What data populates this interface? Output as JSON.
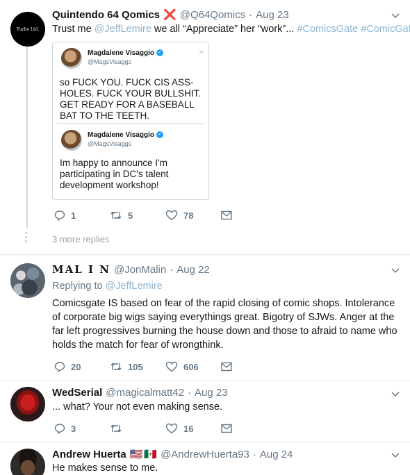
{
  "tweet1": {
    "avatar_text": "Turbo Ltd.",
    "name": "Quintendo 64 Qomics",
    "badge": "❌",
    "handle": "@Q64Qomics",
    "sep": "·",
    "date": "Aug 23",
    "text_prefix": "Trust me ",
    "mention": "@JeffLemire",
    "text_mid": " we all “Appreciate” her “work”... ",
    "hashtag1": "#ComicsGate",
    "hashtag_gap": " ",
    "hashtag2": "#ComicGate",
    "quote1": {
      "name": "Magdalene Visaggio",
      "handle": "@MagsVisaggs",
      "text": "so FUCK YOU. FUCK CIS ASS-HOLES. FUCK YOUR BULLSHIT. GET READY FOR A BASEBALL BAT TO THE TEETH."
    },
    "quote2": {
      "name": "Magdalene Visaggio",
      "handle": "@MagsVisaggs",
      "text": "Im happy to announce I'm participating in DC's talent development workshop!"
    },
    "replies": "1",
    "retweets": "5",
    "likes": "78"
  },
  "more_replies": "3 more replies",
  "tweet2": {
    "name": "MAL I N",
    "handle": "@JonMalin",
    "sep": "·",
    "date": "Aug 22",
    "replying_prefix": "Replying to ",
    "replying_to": "@JeffLemire",
    "text": "Comicsgate IS based on fear of the rapid closing of comic shops. Intolerance of corporate big wigs saying everythings great. Bigotry of SJWs. Anger at the far left progressives burning the house down and those to afraid to name who holds the match for fear of wrongthink.",
    "replies": "20",
    "retweets": "105",
    "likes": "606"
  },
  "tweet3": {
    "name": "WedSerial",
    "handle": "@magicalmatt42",
    "sep": "·",
    "date": "Aug 23",
    "text": "... what? Your not even making sense.",
    "replies": "3",
    "retweets": "",
    "likes": "16"
  },
  "tweet4": {
    "name": "Andrew Huerta",
    "flag1": "🇺🇸",
    "flag2": "🇲🇽",
    "handle": "@AndrewHuerta93",
    "sep": "·",
    "date": "Aug 24",
    "text": "He makes sense to me."
  },
  "colors": {
    "link": "#1da1f2",
    "meta": "#657786",
    "divider": "#e6ecf0"
  }
}
